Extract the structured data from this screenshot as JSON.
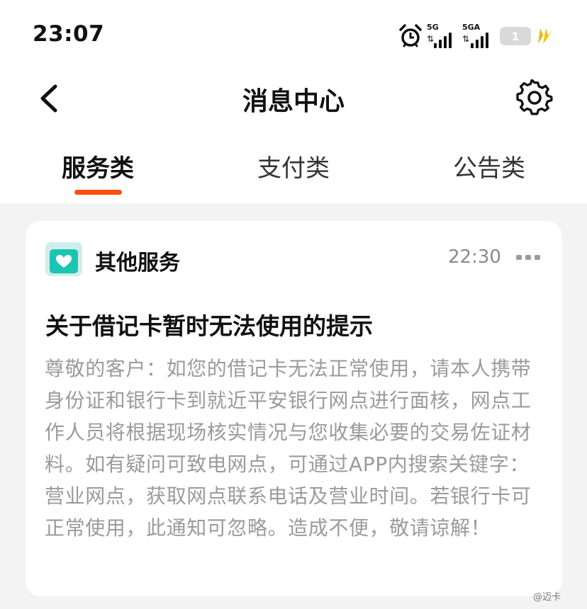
{
  "status_bar": {
    "time": "23:07",
    "signal_1_label": "5G",
    "signal_2_label": "5GA",
    "battery_level": "1",
    "icons": [
      "alarm-icon",
      "signal-icon",
      "signal-icon",
      "battery-icon",
      "charging-icon"
    ]
  },
  "nav": {
    "title": "消息中心",
    "back_icon": "chevron-left-icon",
    "settings_icon": "gear-icon"
  },
  "tabs": [
    {
      "label": "服务类",
      "active": true
    },
    {
      "label": "支付类",
      "active": false
    },
    {
      "label": "公告类",
      "active": false
    }
  ],
  "message": {
    "service_name": "其他服务",
    "service_icon": "heart-card-icon",
    "time": "22:30",
    "title": "关于借记卡暂时无法使用的提示",
    "body": "尊敬的客户：如您的借记卡无法正常使用，请本人携带身份证和银行卡到就近平安银行网点进行面核，网点工作人员将根据现场核实情况与您收集必要的交易佐证材料。如有疑问可致电网点，可通过APP内搜索关键字：营业网点，获取网点联系电话及营业时间。若银行卡可正常使用，此通知可忽略。造成不便，敬请谅解！"
  },
  "watermark": "@迈卡",
  "colors": {
    "accent": "#ff4e10",
    "teal": "#1cc4b4",
    "body_text": "#9b9b9b",
    "background": "#f3f3f3"
  }
}
